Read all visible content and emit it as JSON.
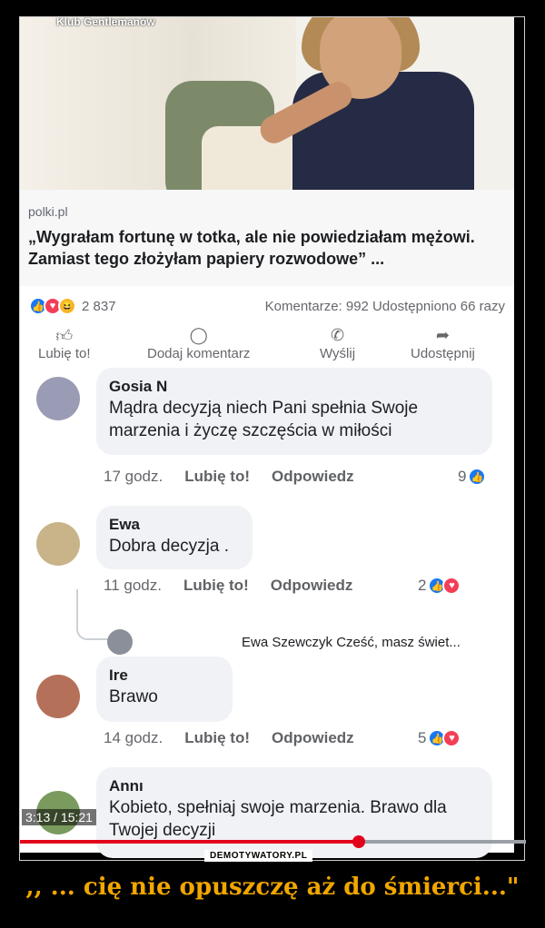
{
  "source_tag": "Klub Gentlemanów",
  "post": {
    "domain": "polki.pl",
    "headline": "„Wygrałam fortunę w totka, ale nie powiedziałam mężowi. Zamiast tego złożyłam papiery rozwodowe” ...",
    "reaction_count": "2 837",
    "stats": "Komentarze: 992  Udostępniono 66 razy"
  },
  "actions": [
    {
      "icon": "thumbs-up-icon",
      "label": "Lubię to!"
    },
    {
      "icon": "comment-icon",
      "label": "Dodaj komentarz"
    },
    {
      "icon": "whatsapp-icon",
      "label": "Wyślij"
    },
    {
      "icon": "share-icon",
      "label": "Udostępnij"
    }
  ],
  "comments": [
    {
      "author": "Gosia N",
      "text": "Mądra decyzją niech Pani spełnia Swoje marzenia i życzę szczęścia w miłości",
      "time": "17 godz.",
      "like": "Lubię to!",
      "reply": "Odpowiedz",
      "reactions": "9"
    },
    {
      "author": "Ewa",
      "text": "Dobra decyzja .",
      "time": "11 godz.",
      "like": "Lubię to!",
      "reply": "Odpowiedz",
      "reactions": "2"
    },
    {
      "author": "Ire",
      "text": "Brawo",
      "time": "14 godz.",
      "like": "Lubię to!",
      "reply": "Odpowiedz",
      "reactions": "5"
    },
    {
      "author": "Annı",
      "text": "Kobieto, spełniaj swoje marzenia. Brawo dla Twojej decyzji",
      "time": "",
      "like": "",
      "reply": "",
      "reactions": ""
    }
  ],
  "reply_preview": "Ewa Szewczyk Cześć, masz świet...",
  "video": {
    "timestamp": "3:13 / 15:21",
    "progress": 0.67
  },
  "watermark": "DEMOTYWATORY.PL",
  "caption": ",, ... cię nie opuszczę aż do śmierci...\"",
  "colors": {
    "facebook_blue": "#1877f2",
    "love_red": "#f33e58",
    "caption_orange": "#f1a600",
    "progress_red": "#e2001a"
  }
}
